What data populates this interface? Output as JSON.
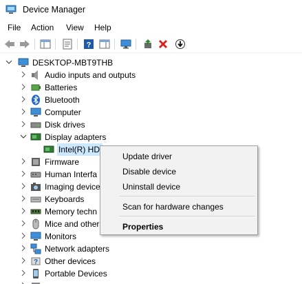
{
  "window": {
    "title": "Device Manager",
    "icon": "device-manager-icon"
  },
  "menu": [
    "File",
    "Action",
    "View",
    "Help"
  ],
  "toolbar": {
    "icons": [
      "back-arrow-icon",
      "forward-arrow-icon",
      "show-hide-tree-icon",
      "properties-icon",
      "help-icon",
      "action-pane-icon",
      "monitor-icon",
      "update-driver-icon",
      "uninstall-icon",
      "scan-download-icon"
    ],
    "colors": {
      "help": "#1e5aa8",
      "uninstall": "#d9201c",
      "update": "#2c8a2c"
    }
  },
  "tree": {
    "root": "DESKTOP-MBT9THB",
    "items": [
      {
        "label": "Audio inputs and outputs",
        "icon": "speaker-icon"
      },
      {
        "label": "Batteries",
        "icon": "battery-icon"
      },
      {
        "label": "Bluetooth",
        "icon": "bluetooth-icon"
      },
      {
        "label": "Computer",
        "icon": "computer-icon"
      },
      {
        "label": "Disk drives",
        "icon": "disk-drive-icon"
      },
      {
        "label": "Display adapters",
        "icon": "display-adapter-icon",
        "expanded": true
      },
      {
        "label": "Intel(R) HD",
        "icon": "display-adapter-icon",
        "child": true,
        "selected": true
      },
      {
        "label": "Firmware",
        "icon": "firmware-icon"
      },
      {
        "label": "Human Interfa",
        "icon": "hid-icon"
      },
      {
        "label": "Imaging device",
        "icon": "camera-icon"
      },
      {
        "label": "Keyboards",
        "icon": "keyboard-icon"
      },
      {
        "label": "Memory techn",
        "icon": "memory-icon"
      },
      {
        "label": "Mice and other",
        "icon": "mouse-icon"
      },
      {
        "label": "Monitors",
        "icon": "monitor-icon"
      },
      {
        "label": "Network adapters",
        "icon": "network-icon"
      },
      {
        "label": "Other devices",
        "icon": "unknown-device-icon"
      },
      {
        "label": "Portable Devices",
        "icon": "portable-device-icon"
      }
    ]
  },
  "context_menu": {
    "items": [
      "Update driver",
      "Disable device",
      "Uninstall device",
      "Scan for hardware changes",
      "Properties"
    ]
  }
}
